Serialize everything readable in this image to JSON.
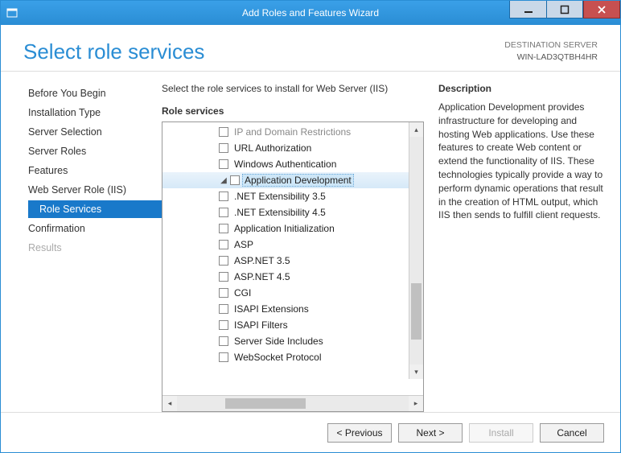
{
  "window": {
    "title": "Add Roles and Features Wizard"
  },
  "header": {
    "page_title": "Select role services",
    "dest_label": "DESTINATION SERVER",
    "dest_value": "WIN-LAD3QTBH4HR"
  },
  "sidebar": {
    "items": [
      {
        "label": "Before You Begin",
        "key": "before-you-begin"
      },
      {
        "label": "Installation Type",
        "key": "installation-type"
      },
      {
        "label": "Server Selection",
        "key": "server-selection"
      },
      {
        "label": "Server Roles",
        "key": "server-roles"
      },
      {
        "label": "Features",
        "key": "features"
      },
      {
        "label": "Web Server Role (IIS)",
        "key": "web-server-role"
      },
      {
        "label": "Role Services",
        "key": "role-services",
        "sub": true,
        "selected": true
      },
      {
        "label": "Confirmation",
        "key": "confirmation"
      },
      {
        "label": "Results",
        "key": "results",
        "disabled": true
      }
    ]
  },
  "main": {
    "instruction": "Select the role services to install for Web Server (IIS)",
    "role_services_label": "Role services",
    "tree": [
      {
        "label": "IP and Domain Restrictions",
        "level": 2,
        "cut": true
      },
      {
        "label": "URL Authorization",
        "level": 2
      },
      {
        "label": "Windows Authentication",
        "level": 2
      },
      {
        "label": "Application Development",
        "level": 1,
        "group": true,
        "expanded": true,
        "selected": true
      },
      {
        "label": ".NET Extensibility 3.5",
        "level": 2
      },
      {
        "label": ".NET Extensibility 4.5",
        "level": 2
      },
      {
        "label": "Application Initialization",
        "level": 2
      },
      {
        "label": "ASP",
        "level": 2
      },
      {
        "label": "ASP.NET 3.5",
        "level": 2
      },
      {
        "label": "ASP.NET 4.5",
        "level": 2
      },
      {
        "label": "CGI",
        "level": 2
      },
      {
        "label": "ISAPI Extensions",
        "level": 2
      },
      {
        "label": "ISAPI Filters",
        "level": 2
      },
      {
        "label": "Server Side Includes",
        "level": 2
      },
      {
        "label": "WebSocket Protocol",
        "level": 2
      }
    ]
  },
  "description": {
    "label": "Description",
    "text": "Application Development provides infrastructure for developing and hosting Web applications. Use these features to create Web content or extend the functionality of IIS. These technologies typically provide a way to perform dynamic operations that result in the creation of HTML output, which IIS then sends to fulfill client requests."
  },
  "footer": {
    "previous": "< Previous",
    "next": "Next >",
    "install": "Install",
    "cancel": "Cancel"
  }
}
